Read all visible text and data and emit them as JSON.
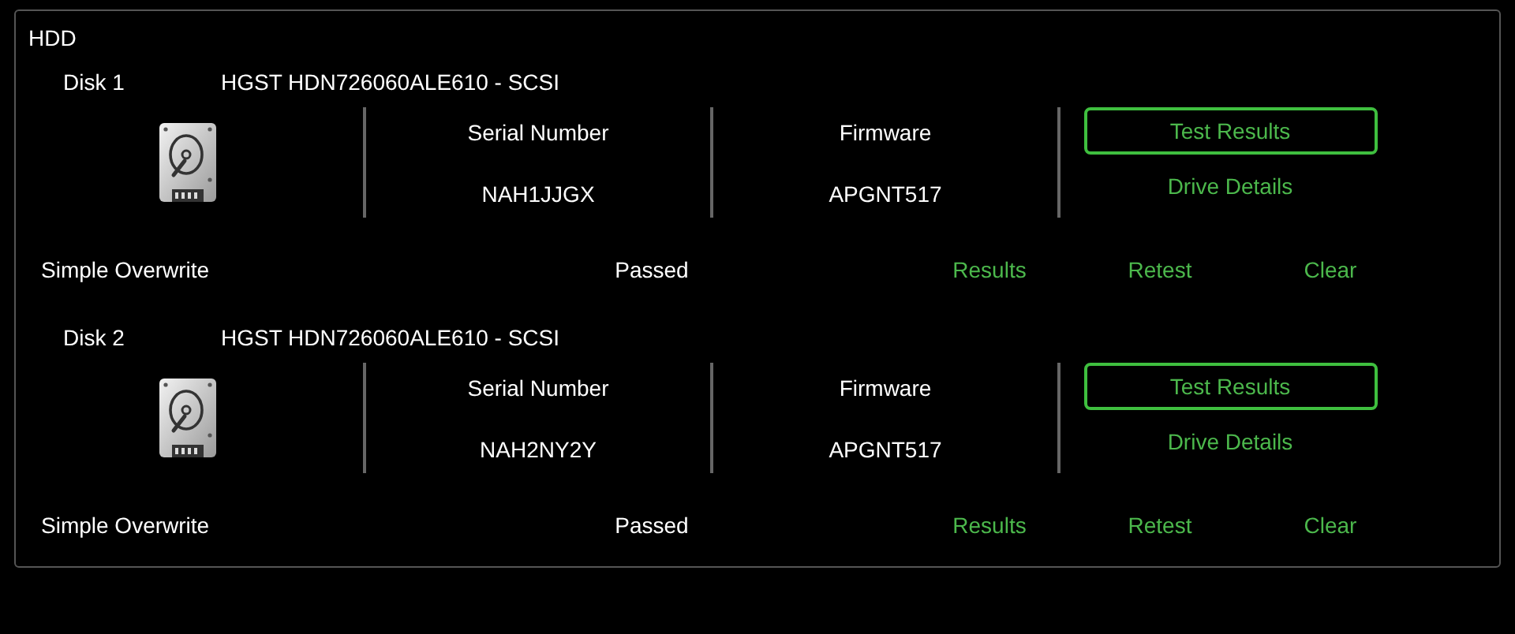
{
  "panel": {
    "title": "HDD"
  },
  "disks": [
    {
      "label": "Disk 1",
      "model": "HGST HDN726060ALE610 - SCSI",
      "serial_label": "Serial Number",
      "serial": "NAH1JJGX",
      "firmware_label": "Firmware",
      "firmware": "APGNT517",
      "buttons": [
        "Test Results",
        "Drive Details"
      ],
      "test": {
        "name": "Simple Overwrite",
        "status": "Passed",
        "actions": [
          "Results",
          "Retest",
          "Clear"
        ]
      }
    },
    {
      "label": "Disk 2",
      "model": "HGST HDN726060ALE610 - SCSI",
      "serial_label": "Serial Number",
      "serial": "NAH2NY2Y",
      "firmware_label": "Firmware",
      "firmware": "APGNT517",
      "buttons": [
        "Test Results",
        "Drive Details"
      ],
      "test": {
        "name": "Simple Overwrite",
        "status": "Passed",
        "actions": [
          "Results",
          "Retest",
          "Clear"
        ]
      }
    }
  ]
}
